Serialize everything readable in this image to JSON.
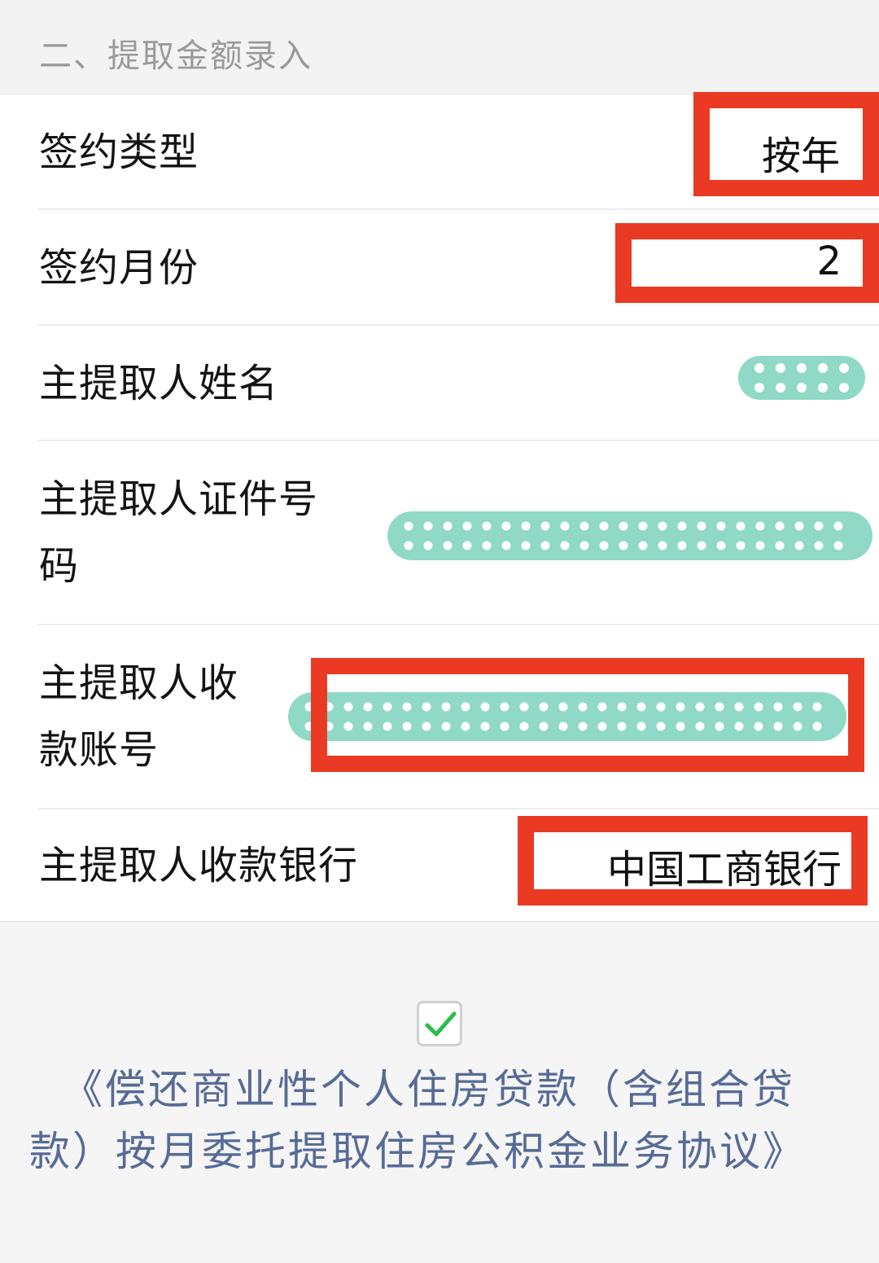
{
  "section": {
    "title": "二、提取金额录入"
  },
  "form": {
    "sign_type": {
      "label": "签约类型",
      "value": "按年"
    },
    "sign_month": {
      "label": "签约月份",
      "value": "2"
    },
    "name": {
      "label": "主提取人姓名",
      "value": ""
    },
    "id_number": {
      "label_line1": "主提取人证件号",
      "label_line2": "码",
      "value": ""
    },
    "account": {
      "label_line1": "主提取人收",
      "label_line2": "款账号",
      "value": ""
    },
    "bank": {
      "label": "主提取人收款银行",
      "value": "中国工商银行"
    }
  },
  "agreement": {
    "checked": true,
    "line1": "《偿还商业性个人住房贷款（含组合贷",
    "line2": "款）按月委托提取住房公积金业务协议》"
  },
  "colors": {
    "highlight_red": "#ea3a24",
    "mask_teal": "#8fd9c6",
    "link_blue": "#576b95",
    "check_green": "#2bbd4a"
  },
  "icons": {
    "checkbox": "checkmark-icon",
    "redaction": "dotted-mask-icon"
  }
}
